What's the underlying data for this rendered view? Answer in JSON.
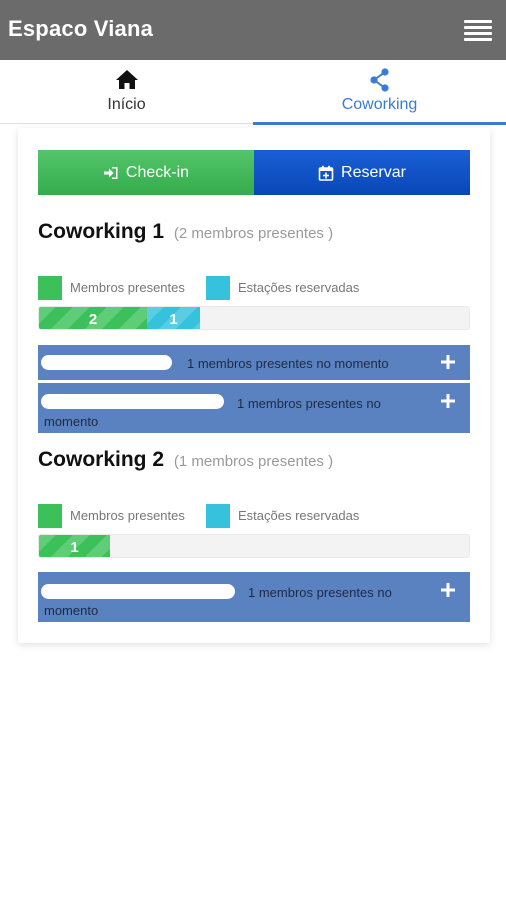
{
  "app": {
    "title": "Espaco Viana"
  },
  "icons": {
    "menu": "hamburger-menu-icon",
    "home": "home-icon",
    "share": "share-icon",
    "checkin": "sign-in-icon",
    "reservar": "calendar-plus-icon",
    "plus": "plus-icon"
  },
  "tabs": [
    {
      "label": "Início",
      "icon": "home-icon",
      "active": false
    },
    {
      "label": "Coworking",
      "icon": "share-icon",
      "active": true
    }
  ],
  "actions": {
    "checkin": "Check-in",
    "reservar": "Reservar"
  },
  "colors": {
    "appbar": "#6b6b6b",
    "accent": "#3a7bd5",
    "present": "#3cc15a",
    "reserved": "#36c1dd",
    "member_row": "#5b82c0",
    "checkin": "#3ab351",
    "reservar": "#0d4cbf"
  },
  "legend": {
    "present": "Membros presentes",
    "reserved": "Estações reservadas"
  },
  "spaces": [
    {
      "name": "Coworking 1",
      "subtitle": "(2 membros presentes )",
      "present": 2,
      "reserved": 1,
      "present_label": "2",
      "reserved_label": "1",
      "members": [
        {
          "text": "1 membros presentes no momento"
        },
        {
          "text_line1": "1 membros presentes no",
          "text_line2": "momento"
        }
      ]
    },
    {
      "name": "Coworking 2",
      "subtitle": "(1 membros presentes )",
      "present": 1,
      "reserved": 0,
      "present_label": "1",
      "members": [
        {
          "text_line1": "1 membros presentes no",
          "text_line2": "momento"
        }
      ]
    }
  ]
}
